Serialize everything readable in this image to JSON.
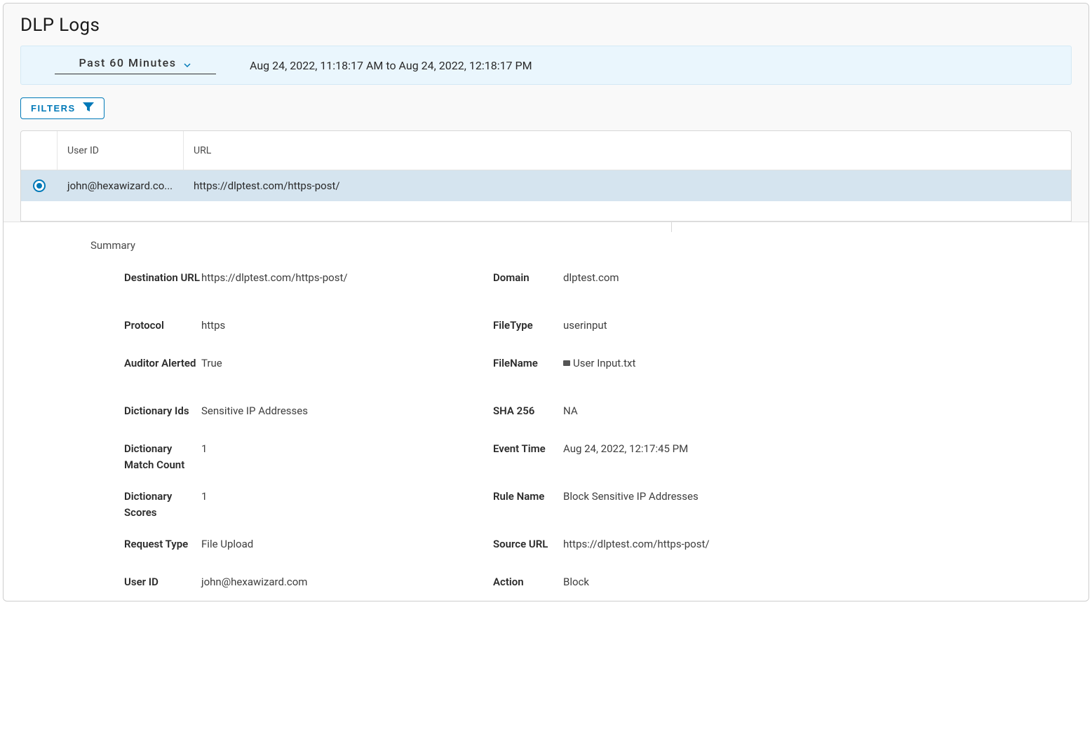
{
  "header": {
    "page_title": "DLP Logs",
    "time_select_label": "Past 60 Minutes",
    "time_range": "Aug 24, 2022, 11:18:17 AM to Aug 24, 2022, 12:18:17 PM",
    "filters_label": "FILTERS"
  },
  "table": {
    "columns": {
      "user_id": "User ID",
      "url": "URL"
    },
    "rows": [
      {
        "user_id": "john@hexawizard.co...",
        "url": "https://dlptest.com/https-post/",
        "selected": true
      }
    ]
  },
  "summary": {
    "heading": "Summary",
    "left": [
      {
        "label": "Destination URL",
        "value": "https://dlptest.com/https-post/",
        "two_line": true
      },
      {
        "label": "Protocol",
        "value": "https"
      },
      {
        "label": "Auditor Alerted",
        "value": "True",
        "two_line": true
      },
      {
        "label": "Dictionary Ids",
        "value": "Sensitive IP Addresses"
      },
      {
        "label": "Dictionary Match Count",
        "value": "1",
        "two_line": true
      },
      {
        "label": "Dictionary Scores",
        "value": "1",
        "two_line": true
      },
      {
        "label": "Request Type",
        "value": "File Upload"
      },
      {
        "label": "User ID",
        "value": "john@hexawizard.com"
      }
    ],
    "right": [
      {
        "label": "Domain",
        "value": "dlptest.com"
      },
      {
        "label": "FileType",
        "value": "userinput"
      },
      {
        "label": "FileName",
        "value": "User Input.txt",
        "file_icon": true
      },
      {
        "label": "SHA 256",
        "value": "NA"
      },
      {
        "label": "Event Time",
        "value": "Aug 24, 2022, 12:17:45 PM"
      },
      {
        "label": "Rule Name",
        "value": "Block Sensitive IP Addresses"
      },
      {
        "label": "Source URL",
        "value": "https://dlptest.com/https-post/"
      },
      {
        "label": "Action",
        "value": "Block"
      }
    ]
  }
}
